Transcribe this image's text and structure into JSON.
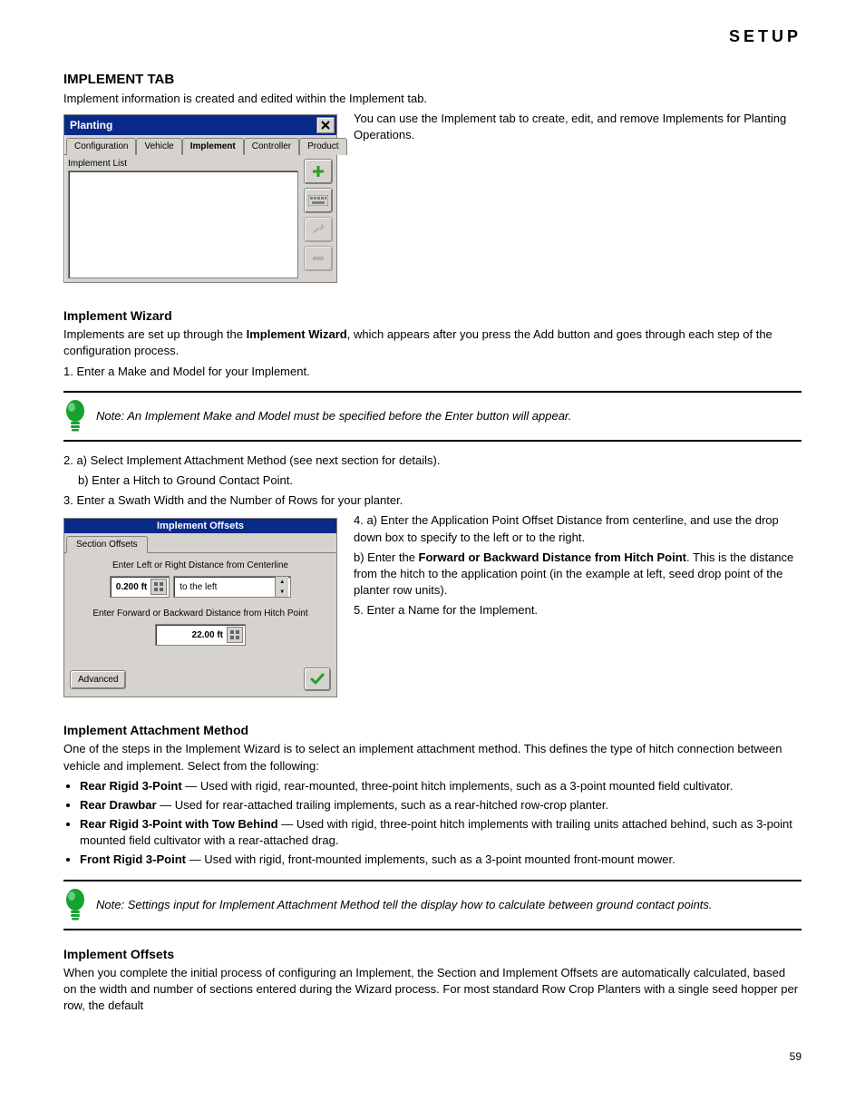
{
  "page_header_right": "SETUP",
  "heading1": "IMPLEMENT TAB",
  "para1": "Implement information is created and edited within the Implement tab.",
  "para2_parts": [
    "You can use the",
    " Implement tab",
    " to create, edit, and remove Implements for Planting Operations."
  ],
  "heading2": "Implement Wizard",
  "para3_parts": [
    "Implements are set up through the ",
    "Implement Wizard",
    ", which appears after you press the Add button and goes through each step of the configuration process."
  ],
  "para4": "1. Enter a Make and Model for your Implement.",
  "note1_prefix": "Note: ",
  "note1_body": "An Implement Make and Model must be specified before the Enter button will appear.",
  "para5": "2. a) Select Implement Attachment Method (see next section for details).",
  "para5b": "b) Enter a Hitch to Ground Contact Point.",
  "para6": "3. Enter a Swath Width and the Number of Rows for your planter.",
  "para7": "4. a) Enter the Application Point Offset Distance from centerline, and use the drop down box to specify to the left or to the right.",
  "para7b_prefix": "b) Enter the ",
  "para7b_bold": "Forward or Backward Distance from Hitch Point",
  "para7b_suffix": ". This is the distance from the hitch to the application point (in the example at left, seed drop point of the planter row units).",
  "para8": "5. Enter a Name for the Implement.",
  "heading3": "Implement Attachment Method",
  "para9": "One of the steps in the Implement Wizard is to select an implement attachment method. This defines the type of hitch connection between vehicle and implement. Select from the following:",
  "bullets": [
    {
      "title": "Rear Rigid 3-Point",
      "desc": " — Used with rigid, rear-mounted, three-point hitch implements, such as a 3-point mounted field cultivator."
    },
    {
      "title": "Rear Drawbar",
      "desc": " — Used for rear-attached trailing implements, such as a rear-hitched row-crop planter."
    },
    {
      "title": "Rear Rigid 3-Point with Tow Behind",
      "desc": " — Used with rigid, three-point hitch implements with trailing units attached behind, such as 3-point mounted field cultivator with a rear-attached drag."
    },
    {
      "title": "Front Rigid 3-Point",
      "desc": " — Used with rigid, front-mounted implements, such as a 3-point mounted front-mount mower."
    }
  ],
  "note2_prefix": "Note: ",
  "note2_body": "Settings input for Implement Attachment Method tell the display how to calculate between ground contact points.",
  "heading4": "Implement Offsets",
  "para10": "When you complete the initial process of configuring an Implement, the Section and Implement Offsets are automatically calculated, based on the width and number of sections entered during the Wizard process. For most standard Row Crop Planters with a single seed hopper per row, the default",
  "footer_page": "59",
  "planting_dialog": {
    "title": "Planting",
    "tabs": [
      "Configuration",
      "Vehicle",
      "Implement",
      "Controller",
      "Product"
    ],
    "active_tab_index": 2,
    "list_label": "Implement List",
    "sidebuttons": [
      "add-icon",
      "keyboard-icon",
      "wrench-icon",
      "minus-icon"
    ]
  },
  "offsets_dialog": {
    "title": "Implement Offsets",
    "tab": "Section Offsets",
    "label_centerline": "Enter Left or Right Distance from Centerline",
    "centerline_value": "0.200 ft",
    "centerline_side": "to the left",
    "label_hitch": "Enter Forward or Backward Distance from Hitch Point",
    "hitch_value": "22.00 ft",
    "advanced": "Advanced"
  }
}
